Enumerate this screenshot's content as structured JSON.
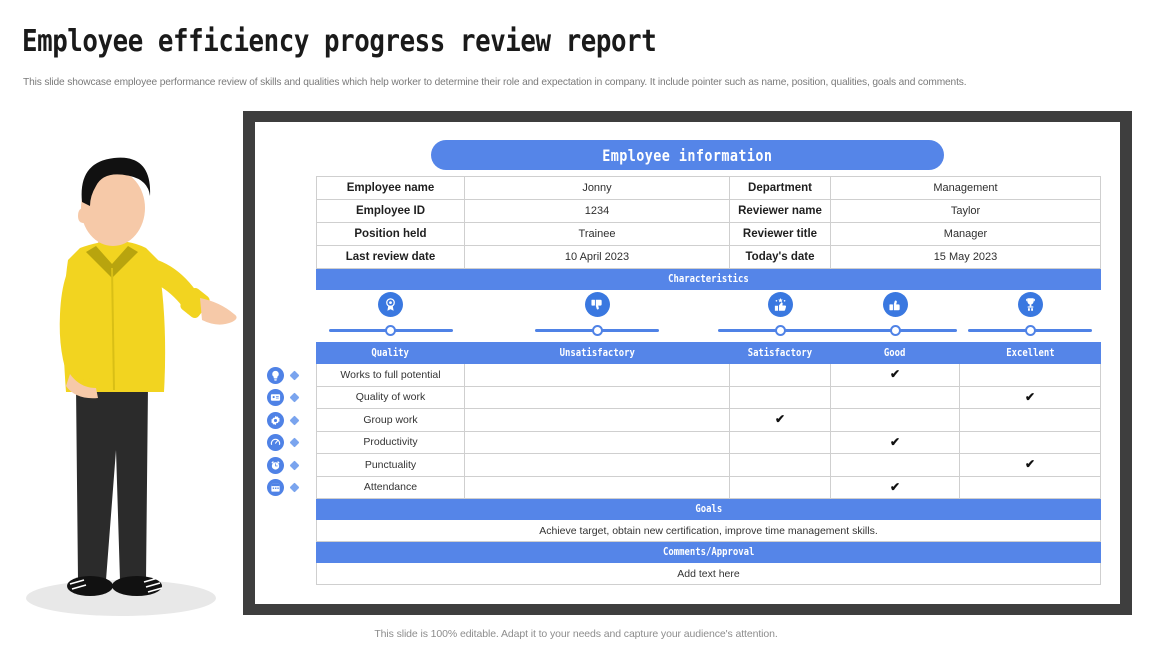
{
  "header": {
    "title": "Employee efficiency progress review report",
    "subtitle": "This slide showcase employee performance review of skills and qualities which help worker to determine their role and expectation in company. It include pointer such as name, position, qualities, goals and comments."
  },
  "footer": {
    "note": "This slide is 100% editable. Adapt it to your needs and capture your audience's attention."
  },
  "colors": {
    "accent": "#5585e8",
    "accent_dark": "#3a78e0",
    "frame": "#3e3e3e",
    "text": "#2f2f2f"
  },
  "card": {
    "pill_title": "Employee information",
    "employee_info_rows": [
      {
        "label_a": "Employee name",
        "value_a": "Jonny",
        "label_b": "Department",
        "value_b": "Management"
      },
      {
        "label_a": "Employee ID",
        "value_a": "1234",
        "label_b": "Reviewer name",
        "value_b": "Taylor"
      },
      {
        "label_a": "Position held",
        "value_a": "Trainee",
        "label_b": "Reviewer title",
        "value_b": "Manager"
      },
      {
        "label_a": "Last review date",
        "value_a": "10 April 2023",
        "label_b": "Today's date",
        "value_b": "15 May 2023"
      }
    ],
    "characteristics_band": "Characteristics",
    "rating_icons": [
      {
        "name": "award-badge-icon"
      },
      {
        "name": "thumbs-down-icon"
      },
      {
        "name": "stars-thumbs-up-icon"
      },
      {
        "name": "thumbs-up-icon"
      },
      {
        "name": "trophy-hand-icon"
      }
    ],
    "rating_columns": [
      "Quality",
      "Unsatisfactory",
      "Satisfactory",
      "Good",
      "Excellent"
    ],
    "rating_rows": [
      {
        "quality": "Works to full potential",
        "rating": "Good",
        "icon": "head-idea-icon"
      },
      {
        "quality": "Quality of work",
        "rating": "Excellent",
        "icon": "id-card-icon"
      },
      {
        "quality": "Group work",
        "rating": "Satisfactory",
        "icon": "teamwork-gear-icon"
      },
      {
        "quality": "Productivity",
        "rating": "Good",
        "icon": "speedometer-icon"
      },
      {
        "quality": "Punctuality",
        "rating": "Excellent",
        "icon": "alarm-clock-icon"
      },
      {
        "quality": "Attendance",
        "rating": "Good",
        "icon": "calendar-icon"
      }
    ],
    "check_mark": "✔",
    "goals_band": "Goals",
    "goals_value": "Achieve target, obtain new certification, improve time management skills.",
    "comments_band": "Comments/Approval",
    "comments_value": "Add text here"
  },
  "illustration": {
    "name": "man-pointing-right-illustration"
  }
}
